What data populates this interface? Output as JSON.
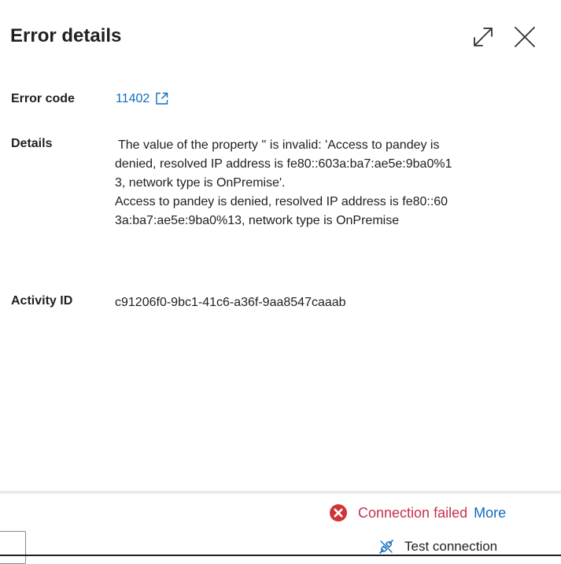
{
  "panel": {
    "title": "Error details",
    "icons": {
      "expand": "expand-icon",
      "close": "close-icon"
    }
  },
  "fields": {
    "error_code": {
      "label": "Error code",
      "value": "11402",
      "icon": "open-external-icon"
    },
    "details": {
      "label": "Details",
      "lines": [
        "The value of the property '' is invalid: 'Access to pandey is",
        "denied, resolved IP address is fe80::603a:ba7:ae5e:9ba0%1",
        "3, network type is OnPremise'.",
        "Access to pandey is denied, resolved IP address is fe80::60",
        "3a:ba7:ae5e:9ba0%13, network type is OnPremise"
      ]
    },
    "activity_id": {
      "label": "Activity ID",
      "value": "c91206f0-9bc1-41c6-a36f-9aa8547caaab"
    }
  },
  "footer": {
    "status_text": "Connection failed",
    "status_icon": "error-circle-icon",
    "status_color": "#c4314b",
    "more_label": "More",
    "test_connection_label": "Test connection",
    "test_connection_icon": "plug-connection-icon"
  },
  "colors": {
    "link": "#0f6cbd",
    "error": "#d13438",
    "text": "#201f1e"
  }
}
